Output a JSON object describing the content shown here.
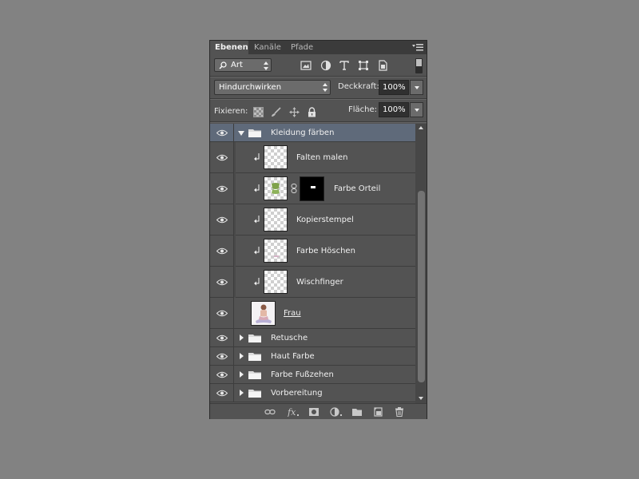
{
  "tabs": [
    {
      "label": "Ebenen",
      "active": true
    },
    {
      "label": "Kanäle",
      "active": false
    },
    {
      "label": "Pfade",
      "active": false
    }
  ],
  "filter": {
    "kind_label": "Art",
    "icons": [
      "pixel-filter-icon",
      "adjustment-filter-icon",
      "type-filter-icon",
      "shape-filter-icon",
      "smart-object-filter-icon"
    ]
  },
  "blend": {
    "mode": "Hindurchwirken",
    "opacity_label": "Deckkraft:",
    "opacity_value": "100%"
  },
  "lock": {
    "label": "Fixieren:",
    "fill_label": "Fläche:",
    "fill_value": "100%"
  },
  "layers": [
    {
      "name": "Kleidung färben",
      "type": "group-open",
      "selected": true
    },
    {
      "name": "Falten malen",
      "type": "clipped-layer"
    },
    {
      "name": "Farbe Orteil",
      "type": "clipped-layer-mask"
    },
    {
      "name": "Kopierstempel",
      "type": "clipped-layer"
    },
    {
      "name": "Farbe Höschen",
      "type": "clipped-layer"
    },
    {
      "name": "Wischfinger",
      "type": "clipped-layer"
    },
    {
      "name": "Frau",
      "type": "base-layer"
    },
    {
      "name": "Retusche",
      "type": "group-closed"
    },
    {
      "name": "Haut Farbe",
      "type": "group-closed"
    },
    {
      "name": "Farbe Fußzehen",
      "type": "group-closed"
    },
    {
      "name": "Vorbereitung",
      "type": "group-closed"
    }
  ],
  "footer_icons": [
    "link-layers-icon",
    "fx-icon",
    "add-mask-icon",
    "adjustment-layer-icon",
    "new-group-icon",
    "new-layer-icon",
    "delete-icon"
  ]
}
